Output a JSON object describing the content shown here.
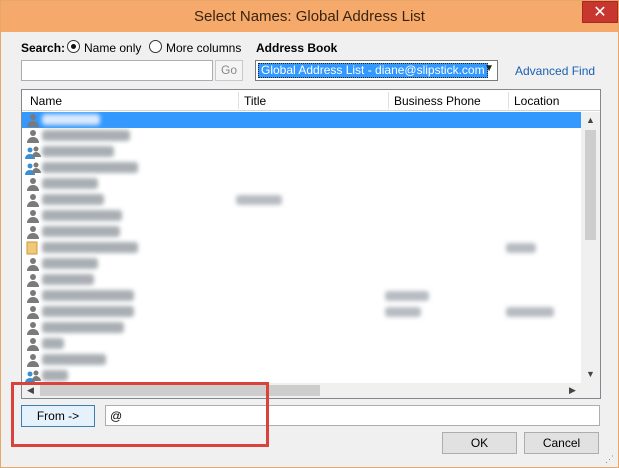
{
  "window": {
    "title": "Select Names: Global Address List",
    "close_glyph": "✕"
  },
  "search": {
    "label": "Search:",
    "options": [
      {
        "label": "Name only",
        "selected": true
      },
      {
        "label": "More columns",
        "selected": false
      }
    ],
    "input_value": "",
    "go_label": "Go"
  },
  "address_book": {
    "label": "Address Book",
    "selected": "Global Address List - diane@slipstick.com",
    "advanced_find": "Advanced Find"
  },
  "list": {
    "columns": [
      "Name",
      "Title",
      "Business Phone",
      "Location"
    ],
    "rows": [
      {
        "icon": "person-icon",
        "selected": true
      },
      {
        "icon": "person-icon",
        "selected": false
      },
      {
        "icon": "group-icon",
        "selected": false
      },
      {
        "icon": "group-icon",
        "selected": false
      },
      {
        "icon": "person-icon",
        "selected": false
      },
      {
        "icon": "person-icon",
        "selected": false
      },
      {
        "icon": "person-icon",
        "selected": false
      },
      {
        "icon": "person-icon",
        "selected": false
      },
      {
        "icon": "folder-icon",
        "selected": false
      },
      {
        "icon": "person-icon",
        "selected": false
      },
      {
        "icon": "person-icon",
        "selected": false
      },
      {
        "icon": "person-icon",
        "selected": false
      },
      {
        "icon": "person-icon",
        "selected": false
      },
      {
        "icon": "person-icon",
        "selected": false
      },
      {
        "icon": "person-icon",
        "selected": false
      },
      {
        "icon": "person-icon",
        "selected": false
      },
      {
        "icon": "group-icon",
        "selected": false
      }
    ]
  },
  "from": {
    "button_label": "From ->",
    "input_value": "@"
  },
  "buttons": {
    "ok": "OK",
    "cancel": "Cancel"
  },
  "colors": {
    "titlebar": "#f5a96a",
    "selection": "#3399ff",
    "highlight_box": "#d9433b",
    "link": "#1a5fb4"
  }
}
